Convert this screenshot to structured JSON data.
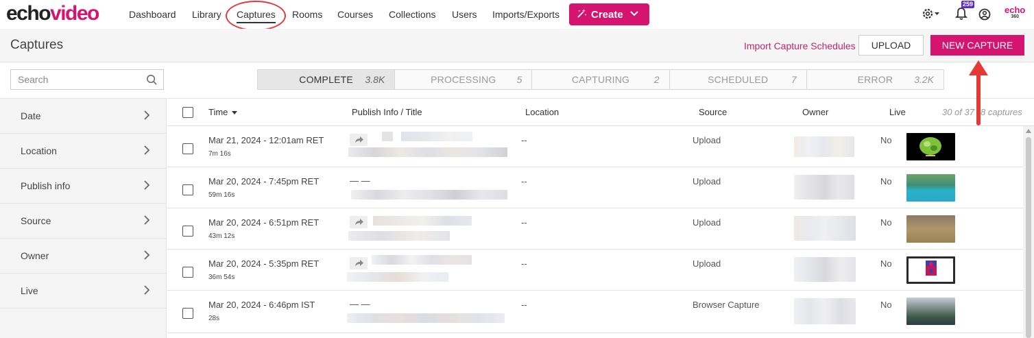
{
  "app": {
    "logo_part1": "echo",
    "logo_part2": "video",
    "brand_mini": "echo",
    "brand_mini_sub": "360",
    "accent_color": "#d4146f"
  },
  "nav": {
    "items": [
      "Dashboard",
      "Library",
      "Captures",
      "Rooms",
      "Courses",
      "Collections",
      "Users",
      "Imports/Exports"
    ],
    "active": "Captures",
    "create_label": "Create",
    "notification_count": "259"
  },
  "header": {
    "title": "Captures",
    "import_link": "Import Capture Schedules",
    "upload_label": "UPLOAD",
    "new_capture_label": "NEW CAPTURE"
  },
  "search": {
    "placeholder": "Search"
  },
  "status_tabs": [
    {
      "label": "COMPLETE",
      "count": "3.8K",
      "active": true
    },
    {
      "label": "PROCESSING",
      "count": "5"
    },
    {
      "label": "CAPTURING",
      "count": "2"
    },
    {
      "label": "SCHEDULED",
      "count": "7"
    },
    {
      "label": "ERROR",
      "count": "3.2K"
    }
  ],
  "sidebar": {
    "items": [
      "Date",
      "Location",
      "Publish info",
      "Source",
      "Owner",
      "Live"
    ]
  },
  "table": {
    "columns": {
      "time": "Time",
      "publish": "Publish Info / Title",
      "location": "Location",
      "source": "Source",
      "owner": "Owner",
      "live": "Live"
    },
    "count_text": "30 of 37",
    "count_text_tail": "8 captures",
    "rows": [
      {
        "time": "Mar 21, 2024 - 12:01am RET",
        "duration": "7m 16s",
        "published": true,
        "location": "--",
        "source": "Upload",
        "live": "No"
      },
      {
        "time": "Mar 20, 2024 - 7:45pm RET",
        "duration": "59m 16s",
        "published": false,
        "publish_dash": "— —",
        "location": "--",
        "source": "Upload",
        "live": "No"
      },
      {
        "time": "Mar 20, 2024 - 6:51pm RET",
        "duration": "43m 12s",
        "published": true,
        "location": "--",
        "source": "Upload",
        "live": "No"
      },
      {
        "time": "Mar 20, 2024 - 5:35pm RET",
        "duration": "36m 54s",
        "published": true,
        "location": "--",
        "source": "Upload",
        "live": "No"
      },
      {
        "time": "Mar 20, 2024 - 6:46pm IST",
        "duration": "28s",
        "published": false,
        "publish_dash": "— —",
        "location": "--",
        "source": "Browser Capture",
        "live": "No"
      }
    ]
  }
}
